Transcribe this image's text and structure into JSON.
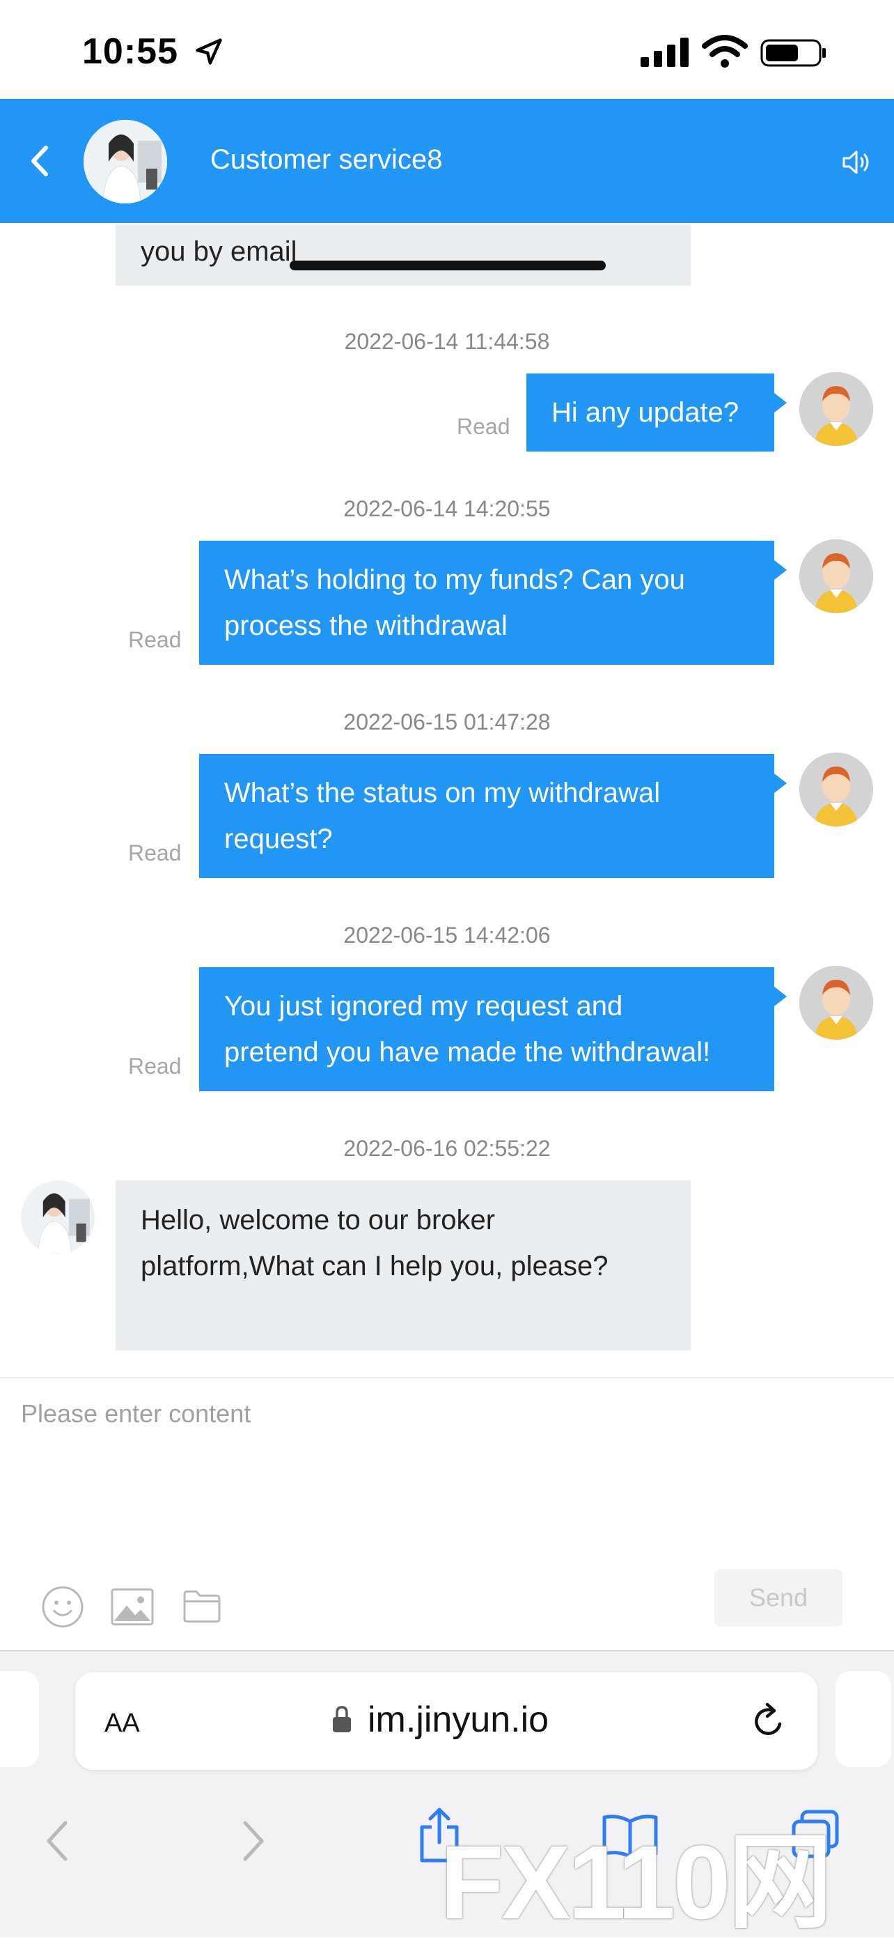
{
  "status_bar": {
    "time": "10:55"
  },
  "header": {
    "title": "Customer service8"
  },
  "chat": {
    "partial_message": "you by email",
    "messages": [
      {
        "timestamp": "2022-06-14 11:44:58",
        "direction": "out",
        "status": "Read",
        "lines": [
          "Hi any update?"
        ]
      },
      {
        "timestamp": "2022-06-14 14:20:55",
        "direction": "out",
        "status": "Read",
        "lines": [
          "What’s holding to my funds? Can you",
          "process the withdrawal"
        ]
      },
      {
        "timestamp": "2022-06-15 01:47:28",
        "direction": "out",
        "status": "Read",
        "lines": [
          "What’s the status on my withdrawal",
          "request?"
        ]
      },
      {
        "timestamp": "2022-06-15 14:42:06",
        "direction": "out",
        "status": "Read",
        "lines": [
          "You just ignored my request and",
          "pretend you have made the withdrawal!"
        ]
      },
      {
        "timestamp": "2022-06-16 02:55:22",
        "direction": "in",
        "lines": [
          "Hello, welcome to our broker",
          "platform,What can I help you, please?"
        ]
      }
    ]
  },
  "composer": {
    "placeholder": "Please enter content",
    "send_label": "Send"
  },
  "browser": {
    "text_size_label": "AA",
    "url": "im.jinyun.io"
  },
  "watermark": "FX110网",
  "colors": {
    "accent": "#2196f5",
    "incoming_bubble": "#ebeef0"
  }
}
